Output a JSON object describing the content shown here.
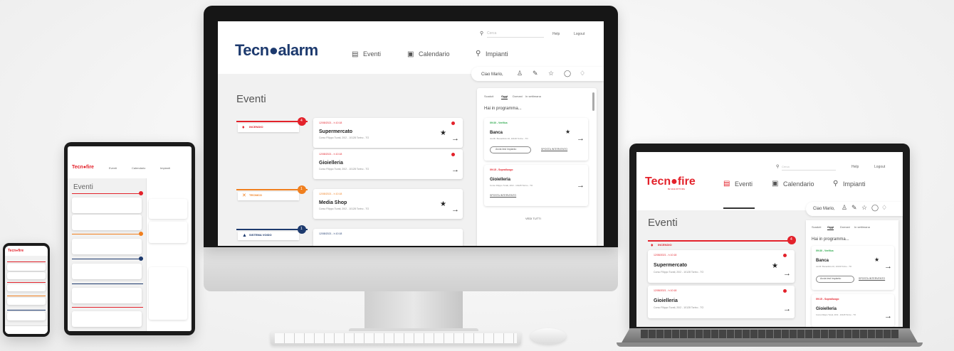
{
  "app": {
    "brand_desktop": "Tecn●alarm",
    "brand_fire": "Tecn●fire",
    "brand_tagline": "BE SAFE WITH FIRE"
  },
  "nav": {
    "events": "Eventi",
    "calendar": "Calendario",
    "plants": "Impianti",
    "help": "Help",
    "logout": "Logout",
    "search_placeholder": "Cerca"
  },
  "user": {
    "greeting": "Ciao Mario,"
  },
  "main": {
    "title": "Eventi",
    "groups": [
      {
        "label": "INCENDIO",
        "count": "4",
        "color": "#e3222b",
        "icon": "fire-icon"
      },
      {
        "label": "TECNICO",
        "count": "1",
        "color": "#f07f1e",
        "icon": "wrench-icon"
      },
      {
        "label": "SISTEMA VOIDO",
        "count": "1",
        "color": "#1d3a6e",
        "icon": "bell-icon"
      }
    ],
    "events": [
      {
        "date": "12/08/2021 - h 10:18",
        "title": "Supermercato",
        "address": "Corso Filippo Turati, 20/2 - 10128 Torino - TO",
        "starred": true
      },
      {
        "date": "12/08/2021 - h 10:18",
        "title": "Gioielleria",
        "address": "Corso Filippo Turati, 20/2 - 10128 Torino - TO",
        "starred": false
      },
      {
        "date": "12/08/2021 - h 10:18",
        "title": "Media Shop",
        "address": "Corso Filippo Turati, 20/2 - 10128 Torino - TO",
        "starred": true
      },
      {
        "date": "12/08/2021 - h 10:18",
        "title": "",
        "address": "",
        "starred": false
      }
    ]
  },
  "sidepanel": {
    "tabs": [
      "Scaduti",
      "Oggi",
      "Domani",
      "In settimana"
    ],
    "active_tab": "Oggi",
    "heading": "Hai in programma...",
    "items": [
      {
        "time": "09:30 - Verifica",
        "title": "Banca",
        "address": "via Mr. Bonardinis 10, 10130 Torino - TO",
        "btn": "Avvia test impianto",
        "link": "SPOSTA INTERVENTO"
      },
      {
        "time": "09:15 - Sopralluogo",
        "title": "Gioielleria",
        "address": "Corso Filippo Turati, 20/2 - 10128 Torino - TO",
        "link": "SPOSTA INTERVENTO"
      }
    ],
    "more": "VEDI TUTTI"
  },
  "colors": {
    "fire": "#e3222b",
    "tech": "#f07f1e",
    "system": "#1d3a6e",
    "green": "#2aa84a"
  }
}
